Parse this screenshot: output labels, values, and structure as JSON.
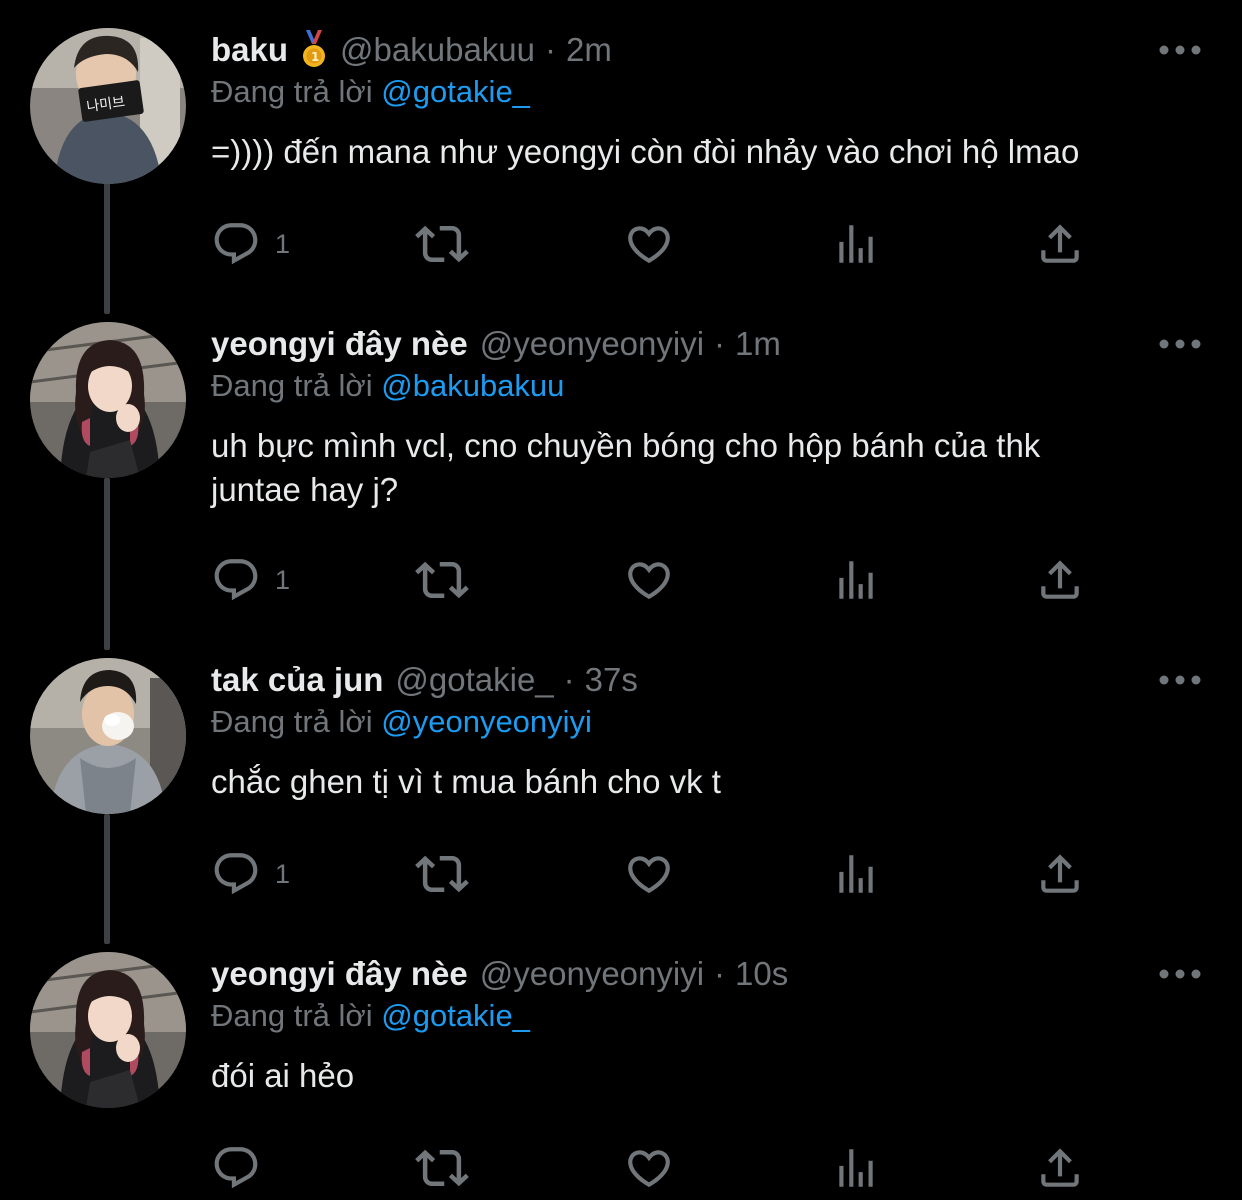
{
  "colors": {
    "background": "#000000",
    "text": "#e7e9ea",
    "muted": "#71767b",
    "accent": "#1d9bf0",
    "thread_line": "#3d4146"
  },
  "tweets": [
    {
      "display_name": "baku",
      "badge_icon": "medal-icon",
      "handle": "@bakubakuu",
      "dot": "·",
      "time": "2m",
      "reply_prefix": "Đang trả lời",
      "reply_to": "@gotakie_",
      "text": "=)))) đến mana như yeongyi còn đòi nhảy vào chơi hộ lmao",
      "reply_count": "1",
      "avatar_text": "나미브"
    },
    {
      "display_name": "yeongyi đây nèe",
      "handle": "@yeonyeonyiyi",
      "dot": "·",
      "time": "1m",
      "reply_prefix": "Đang trả lời",
      "reply_to": "@bakubakuu",
      "text_line1": "uh bực mình vcl, cno chuyền bóng cho hộp bánh của thk",
      "text_line2": "juntae hay j?",
      "reply_count": "1"
    },
    {
      "display_name": "tak của jun",
      "handle": "@gotakie_",
      "dot": "·",
      "time": "37s",
      "reply_prefix": "Đang trả lời",
      "reply_to": "@yeonyeonyiyi",
      "text": "chắc ghen tị vì t mua bánh cho vk t",
      "reply_count": "1"
    },
    {
      "display_name": "yeongyi đây nèe",
      "handle": "@yeonyeonyiyi",
      "dot": "·",
      "time": "10s",
      "reply_prefix": "Đang trả lời",
      "reply_to": "@gotakie_",
      "text": "đói ai hẻo",
      "reply_count": ""
    }
  ]
}
